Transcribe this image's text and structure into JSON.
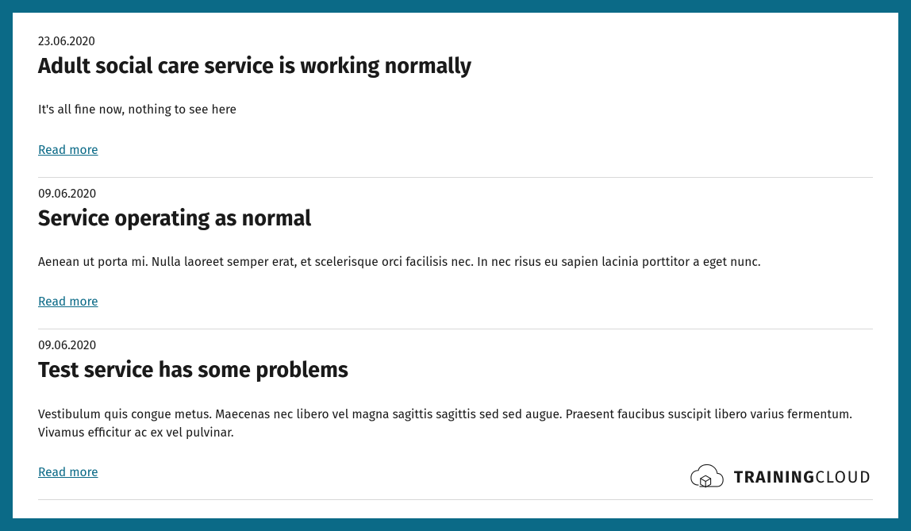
{
  "posts": [
    {
      "date": "23.06.2020",
      "title": "Adult social care service is working normally",
      "desc": "It's all fine now, nothing to see here",
      "link": "Read more"
    },
    {
      "date": "09.06.2020",
      "title": "Service operating as normal",
      "desc": "Aenean ut porta mi. Nulla laoreet semper erat, et scelerisque orci facilisis nec. In nec risus eu sapien lacinia porttitor a eget nunc.",
      "link": "Read more"
    },
    {
      "date": "09.06.2020",
      "title": "Test service has some problems",
      "desc": "Vestibulum quis congue metus. Maecenas nec libero vel magna sagittis sagittis sed sed augue. Praesent faucibus suscipit libero varius fermentum. Vivamus efficitur ac ex vel pulvinar.",
      "link": "Read more"
    }
  ],
  "brand": {
    "part1": "TRAINING",
    "part2": "CLOUD"
  }
}
